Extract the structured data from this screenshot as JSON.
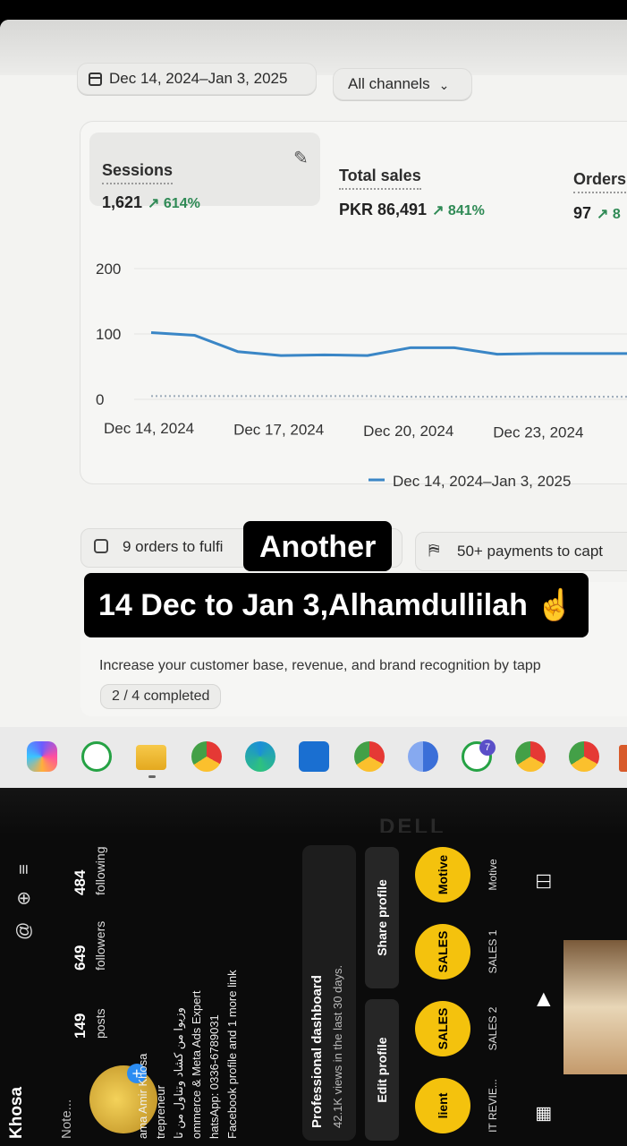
{
  "filters": {
    "date_range": "Dec 14, 2024–Jan 3, 2025",
    "channel": "All channels"
  },
  "metrics": [
    {
      "label": "Sessions",
      "value": "1,621",
      "change": "↗ 614%"
    },
    {
      "label": "Total sales",
      "value": "PKR 86,491",
      "change": "↗ 841%"
    },
    {
      "label": "Orders",
      "value": "97",
      "change": "↗ 8"
    }
  ],
  "chart_data": {
    "type": "line",
    "x": [
      "Dec 14, 2024",
      "Dec 15, 2024",
      "Dec 16, 2024",
      "Dec 17, 2024",
      "Dec 18, 2024",
      "Dec 19, 2024",
      "Dec 20, 2024",
      "Dec 21, 2024",
      "Dec 22, 2024",
      "Dec 23, 2024",
      "Dec 24, 2024",
      "Dec 25, 2024"
    ],
    "x_tick_labels": [
      "Dec 14, 2024",
      "Dec 17, 2024",
      "Dec 20, 2024",
      "Dec 23, 2024"
    ],
    "series": [
      {
        "name": "Dec 14, 2024–Jan 3, 2025",
        "values": [
          102,
          98,
          73,
          67,
          68,
          67,
          79,
          79,
          69,
          70,
          70,
          70
        ],
        "color": "#3a86c6"
      },
      {
        "name": "",
        "values": [
          5,
          5,
          5,
          5,
          5,
          5,
          4,
          4,
          4,
          4,
          4,
          4
        ],
        "color": "#9aa9b8",
        "dashed": true
      }
    ],
    "y_ticks": [
      0,
      100,
      200
    ],
    "ylim": [
      0,
      200
    ],
    "grid": true,
    "legend": "bottom-right"
  },
  "cards": {
    "orders_to_fulfill": "9 orders to fulfi",
    "payments_to_capture": "50+ payments to capt",
    "growth_description": "Increase your customer base, revenue, and brand recognition by tapp",
    "progress": "2 / 4 completed"
  },
  "captions": {
    "line1": "Another",
    "line2": "14 Dec to Jan 3,Alhamdullilah ☝"
  },
  "taskbar": {
    "whatsapp_badge": "7",
    "icons": [
      "copilot-icon",
      "whatsapp-icon",
      "file-explorer-icon",
      "chrome-icon",
      "edge-icon",
      "store-icon",
      "chrome-icon",
      "chrome-icon",
      "whatsapp-icon",
      "chrome-icon",
      "chrome-icon"
    ]
  },
  "laptop_brand": "DELL",
  "phone": {
    "username": "Khosa",
    "note": "Note...",
    "stats": [
      {
        "num": "149",
        "label": "posts"
      },
      {
        "num": "649",
        "label": "followers"
      },
      {
        "num": "484",
        "label": "following"
      }
    ],
    "bio": [
      "ama Amir Khosa",
      "trepreneur",
      "وزیوا من کشاد وتناول من تا",
      "ommerce & Meta Ads Expert",
      "hatsApp: 0336-6789031",
      "Facebook profile and 1 more link"
    ],
    "dashboard_title": "Professional dashboard",
    "dashboard_sub": "42.1K views in the last 30 days.",
    "buttons": [
      "Edit profile",
      "Share profile"
    ],
    "highlights": [
      {
        "badge": "lient",
        "label": "IT REVIE..."
      },
      {
        "badge": "SALES",
        "label": "SALES 2"
      },
      {
        "badge": "SALES",
        "label": "SALES 1"
      },
      {
        "badge": "Motive",
        "label": "Motive"
      }
    ]
  }
}
